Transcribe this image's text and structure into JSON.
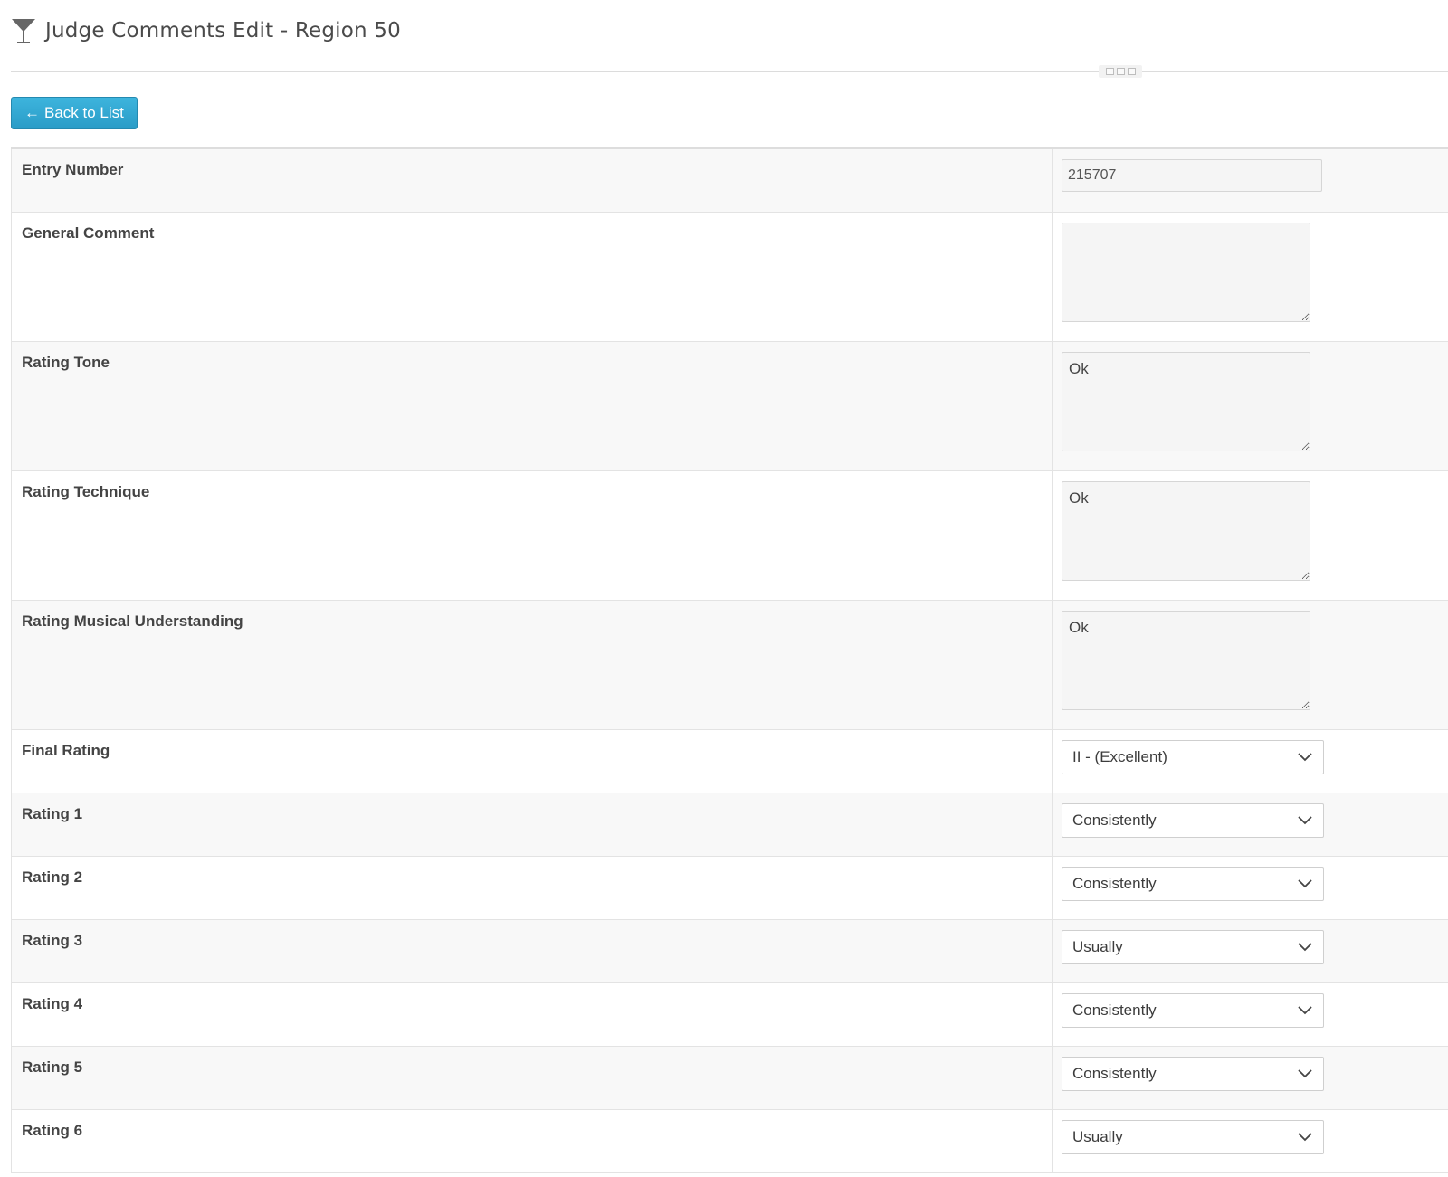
{
  "header": {
    "title": "Judge Comments Edit - Region 50",
    "icon": "cocktail-glass-icon"
  },
  "toolbar": {
    "back_label": "Back to List",
    "back_arrow": "←"
  },
  "annotation": {
    "arrow_color": "#f0331a"
  },
  "form": {
    "entry_number": {
      "label": "Entry Number",
      "value": "215707"
    },
    "general_comment": {
      "label": "General Comment",
      "value": ""
    },
    "rating_tone": {
      "label": "Rating Tone",
      "value": "Ok"
    },
    "rating_technique": {
      "label": "Rating Technique",
      "value": "Ok"
    },
    "rating_musical": {
      "label": "Rating Musical Understanding",
      "value": "Ok"
    },
    "final_rating": {
      "label": "Final Rating",
      "value": "II - (Excellent)"
    },
    "rating_1": {
      "label": "Rating 1",
      "value": "Consistently"
    },
    "rating_2": {
      "label": "Rating 2",
      "value": "Consistently"
    },
    "rating_3": {
      "label": "Rating 3",
      "value": "Usually"
    },
    "rating_4": {
      "label": "Rating 4",
      "value": "Consistently"
    },
    "rating_5": {
      "label": "Rating 5",
      "value": "Consistently"
    },
    "rating_6": {
      "label": "Rating 6",
      "value": "Usually"
    }
  },
  "colors": {
    "button": "#2a9cc7",
    "arrow": "#f0331a"
  }
}
